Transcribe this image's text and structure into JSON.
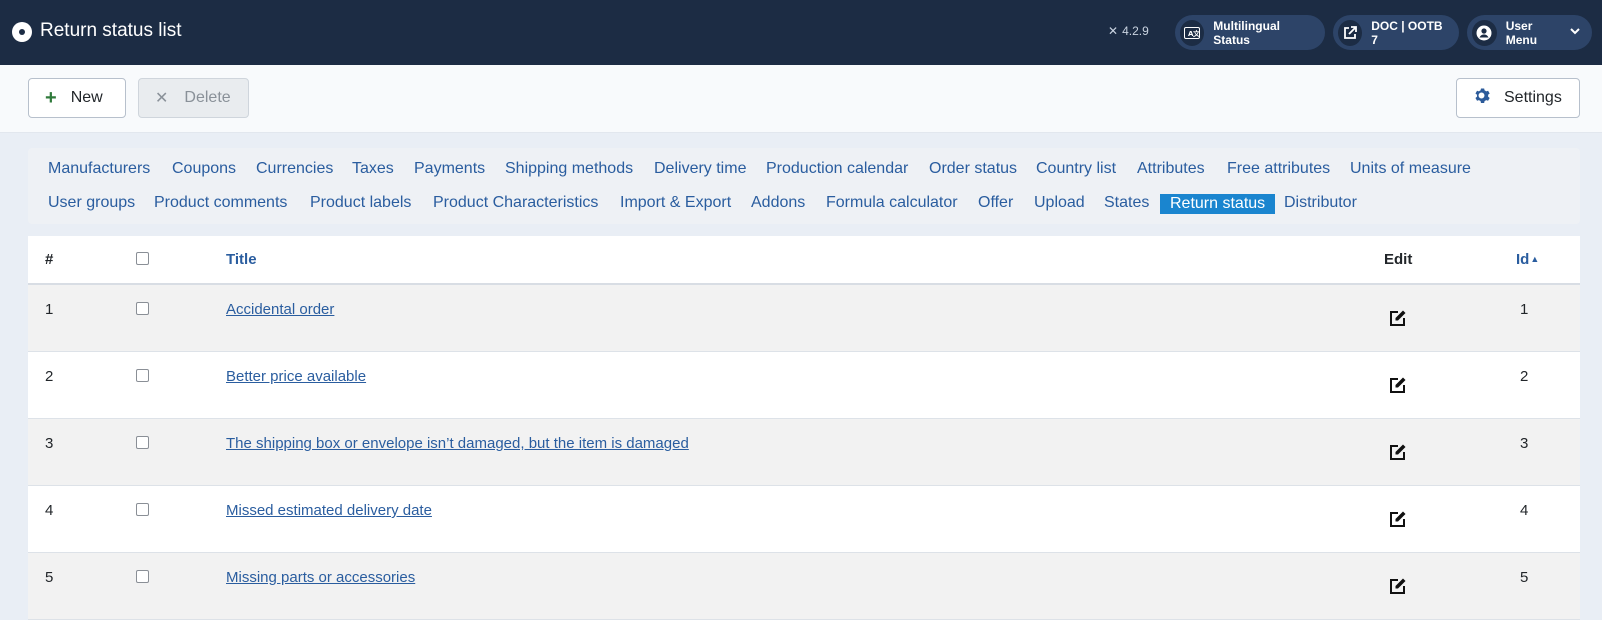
{
  "header": {
    "title": "Return status list",
    "version": "4.2.9",
    "multilingual_label": "Multilingual Status",
    "doc_label": "DOC | OOTB 7",
    "user_menu_label": "User Menu"
  },
  "toolbar": {
    "new_label": "New",
    "delete_label": "Delete",
    "settings_label": "Settings"
  },
  "submenu": {
    "row1": [
      "Manufacturers",
      "Coupons",
      "Currencies",
      "Taxes",
      "Payments",
      "Shipping methods",
      "Delivery time",
      "Production calendar",
      "Order status",
      "Country list",
      "Attributes",
      "Free attributes",
      "Units of measure"
    ],
    "row2": [
      "User groups",
      "Product comments",
      "Product labels",
      "Product Characteristics",
      "Import & Export",
      "Addons",
      "Formula calculator",
      "Offer",
      "Upload",
      "States",
      "Return status",
      "Distributor"
    ],
    "active": "Return status"
  },
  "table": {
    "headers": {
      "num": "#",
      "title": "Title",
      "edit": "Edit",
      "id": "Id"
    },
    "rows": [
      {
        "num": "1",
        "title": "Accidental order",
        "id": "1"
      },
      {
        "num": "2",
        "title": "Better price available",
        "id": "2"
      },
      {
        "num": "3",
        "title": "The shipping box or envelope isn’t damaged, but the item is damaged",
        "id": "3"
      },
      {
        "num": "4",
        "title": "Missed estimated delivery date",
        "id": "4"
      },
      {
        "num": "5",
        "title": "Missing parts or accessories",
        "id": "5"
      }
    ]
  }
}
